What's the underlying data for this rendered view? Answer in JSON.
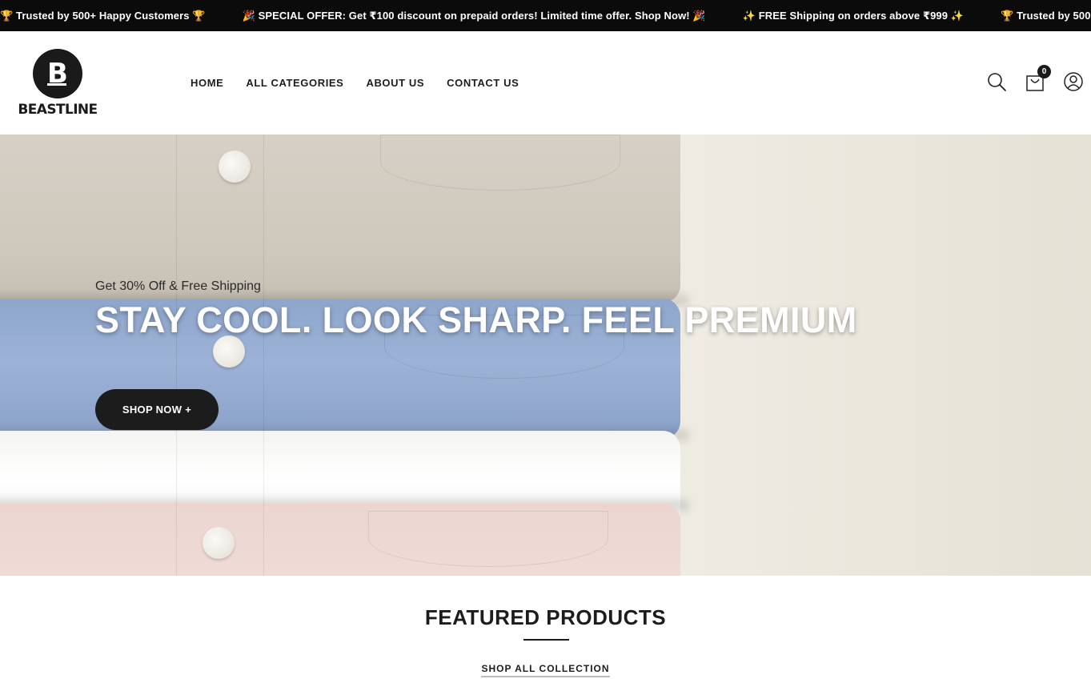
{
  "announcement": {
    "messages": [
      "🏆 Trusted by 500+ Happy Customers 🏆",
      "🎉 SPECIAL OFFER: Get ₹100 discount on prepaid orders! Limited time offer. Shop Now! 🎉",
      "✨ FREE Shipping on orders above ₹999 ✨",
      "🏆 Trusted by 500+ Happy Customers 🏆"
    ]
  },
  "brand": {
    "name": "BEASTLINE",
    "logo_letter": "B"
  },
  "nav": {
    "items": [
      {
        "label": "HOME"
      },
      {
        "label": "ALL CATEGORIES"
      },
      {
        "label": "ABOUT US"
      },
      {
        "label": "CONTACT US"
      }
    ]
  },
  "header_icons": {
    "search": "search-icon",
    "cart": "shopping-bag-icon",
    "cart_count": "0",
    "account": "user-icon"
  },
  "hero": {
    "subtitle": "Get 30% Off & Free Shipping",
    "title": "STAY COOL. LOOK SHARP. FEEL PREMIUM",
    "cta_label": "SHOP NOW +"
  },
  "featured": {
    "title": "FEATURED PRODUCTS",
    "link_label": "SHOP ALL COLLECTION"
  },
  "colors": {
    "topbar_bg": "#0b0b0b",
    "button_bg": "#1c1c1c",
    "text": "#1f1f1f"
  }
}
